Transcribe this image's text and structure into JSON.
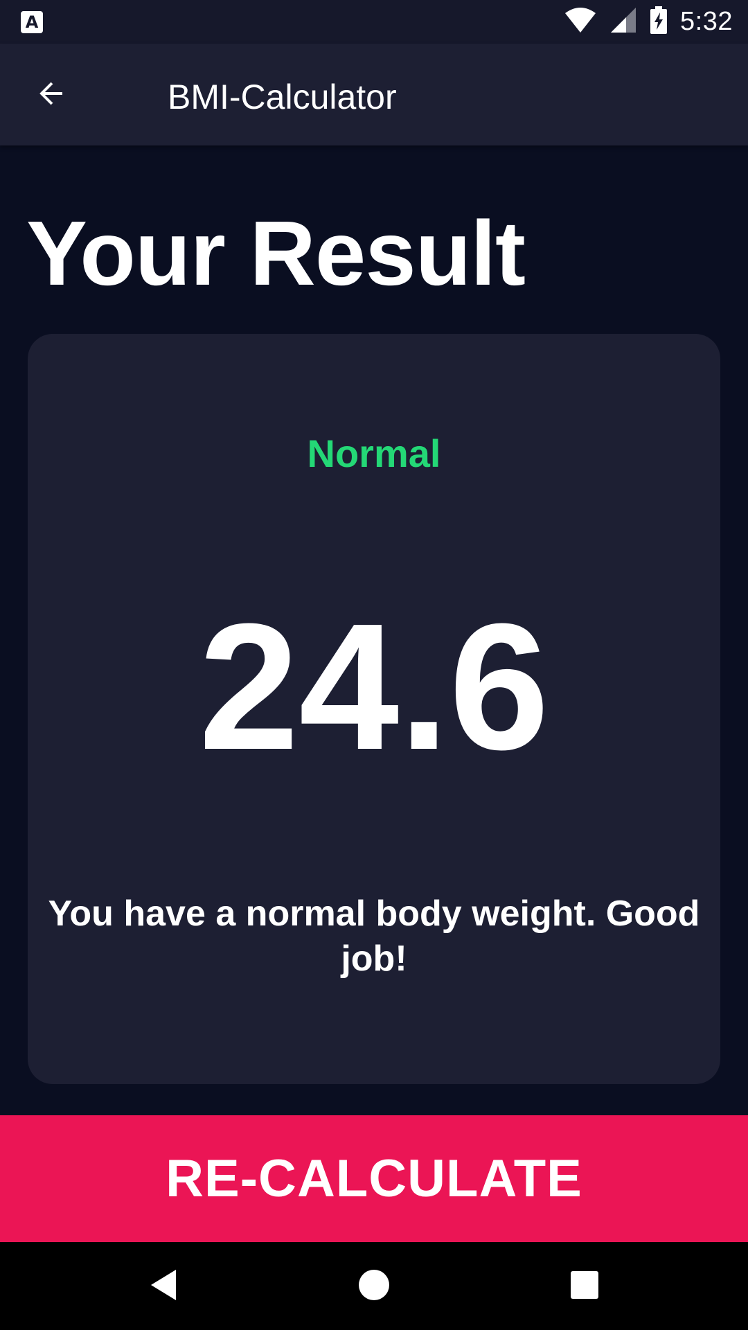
{
  "status_bar": {
    "notification_icon": "A",
    "time": "5:32",
    "icons": [
      "wifi-icon",
      "signal-icon",
      "battery-charging-icon"
    ]
  },
  "app_bar": {
    "title": "BMI-Calculator",
    "back_icon": "arrow-back-icon"
  },
  "page": {
    "title": "Your Result"
  },
  "result": {
    "status": "Normal",
    "value": "24.6",
    "message": "You have a normal body weight. Good job!"
  },
  "actions": {
    "recalculate_label": "RE-CALCULATE"
  },
  "nav_bar": {
    "icons": [
      "nav-back-icon",
      "nav-home-icon",
      "nav-recents-icon"
    ]
  },
  "colors": {
    "background": "#0a0e21",
    "card": "#1d1f33",
    "accent": "#eb1555",
    "status_normal": "#24d876"
  }
}
